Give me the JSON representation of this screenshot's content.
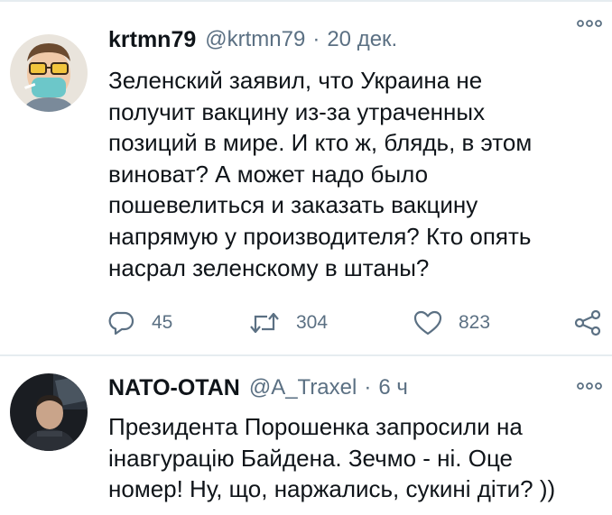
{
  "tweets": [
    {
      "author_name": "krtmn79",
      "handle": "@krtmn79",
      "separator": "·",
      "time": "20 дек.",
      "text_lines": [
        "Зеленский заявил, что Украина не",
        "получит вакцину из-за утраченных",
        "позиций в мире. И кто ж, блядь, в этом",
        "виноват? А может надо было",
        "пошевелиться и заказать вакцину",
        "напрямую у производителя? Кто опять",
        "насрал зеленскому в штаны?"
      ],
      "replies": "45",
      "retweets": "304",
      "likes": "823"
    },
    {
      "author_name": "NATO-OTAN",
      "handle": "@A_Traxel",
      "separator": "·",
      "time": "6 ч",
      "text_lines": [
        "Президента Порошенка запросили на",
        "інавгурацію Байдена. Зечмо - ні. Оце",
        "номер! Ну, що, наржались, сукині діти? ))"
      ]
    }
  ],
  "colors": {
    "text": "#0f1419",
    "secondary": "#5b7083",
    "divider": "#e6ecf0"
  },
  "icons": [
    "more-icon",
    "reply-icon",
    "retweet-icon",
    "like-icon",
    "share-icon"
  ]
}
